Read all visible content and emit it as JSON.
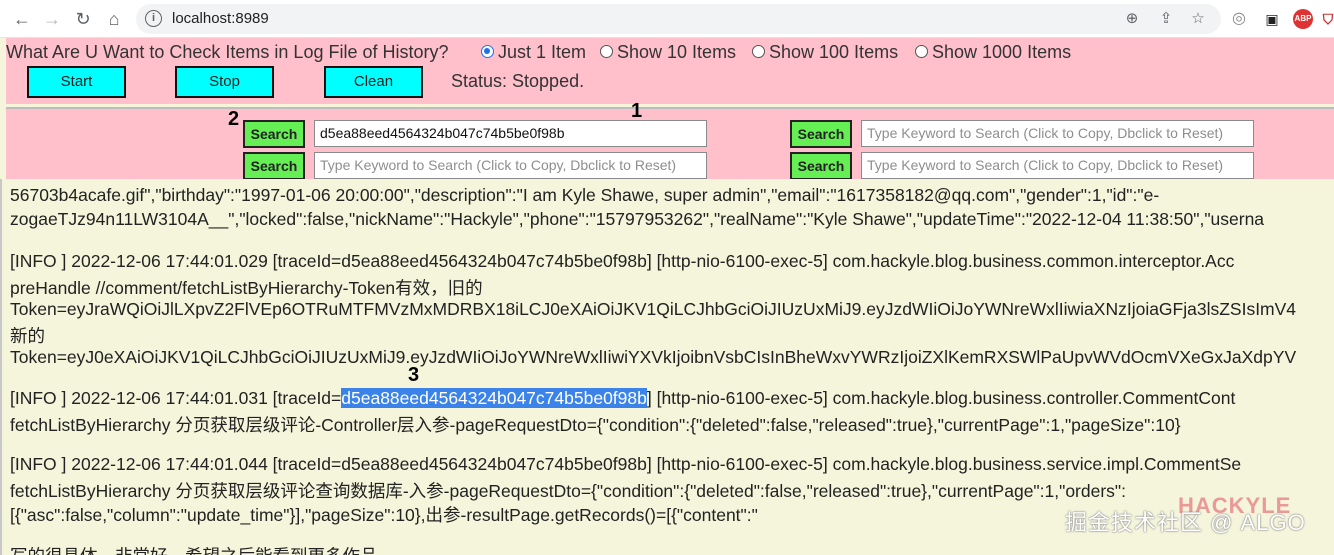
{
  "browser": {
    "url": "localhost:8989",
    "ext_labels": [
      "ABP"
    ]
  },
  "controls": {
    "question": "What Are U Want to Check Items in Log File of History?",
    "options": [
      "Just 1 Item",
      "Show 10 Items",
      "Show 100 Items",
      "Show 1000 Items"
    ],
    "selected_option": "Just 1 Item",
    "start_label": "Start",
    "stop_label": "Stop",
    "clean_label": "Clean",
    "status_text": "Status: Stopped."
  },
  "search": {
    "button_label": "Search",
    "placeholder": "Type Keyword to Search (Click to Copy, Dbclick to Reset)",
    "box1_value": "d5ea88eed4564324b047c74b5be0f98b",
    "markers": [
      "1",
      "2",
      "3"
    ]
  },
  "log": {
    "l0": "56703b4acafe.gif\",\"birthday\":\"1997-01-06 20:00:00\",\"description\":\"I am Kyle Shawe, super admin\",\"email\":\"1617358182@qq.com\",\"gender\":1,\"id\":\"e-",
    "l1": "zogaeTJz94n11LW3104A__\",\"locked\":false,\"nickName\":\"Hackyle\",\"phone\":\"15797953262\",\"realName\":\"Kyle Shawe\",\"updateTime\":\"2022-12-04 11:38:50\",\"userna",
    "l2": "[INFO ] 2022-12-06 17:44:01.029 [traceId=d5ea88eed4564324b047c74b5be0f98b] [http-nio-6100-exec-5] com.hackyle.blog.business.common.interceptor.Acc",
    "l3": "preHandle //comment/fetchListByHierarchy-Token有效，旧的",
    "l4": "Token=eyJraWQiOiJlLXpvZ2FlVEp6OTRuMTFMVzMxMDRBX18iLCJ0eXAiOiJKV1QiLCJhbGciOiJIUzUxMiJ9.eyJzdWIiOiJoYWNreWxlIiwiaXNzIjoiaGFja3lsZSIsImV4",
    "l5": "新的",
    "l6": "Token=eyJ0eXAiOiJKV1QiLCJhbGciOiJIUzUxMiJ9.eyJzdWIiOiJoYWNreWxlIiwiYXVkIjoibnVsbCIsInBheWxvYWRzIjoiZXlKemRXSWlPaUpvWVdOcmVXeGxJaXdpYV",
    "l7_pre": "[INFO ] 2022-12-06 17:44:01.031 [traceId=",
    "l7_hl": "d5ea88eed4564324b047c74b5be0f98b",
    "l7_post": "] [http-nio-6100-exec-5] com.hackyle.blog.business.controller.CommentCont",
    "l8": "fetchListByHierarchy 分页获取层级评论-Controller层入参-pageRequestDto={\"condition\":{\"deleted\":false,\"released\":true},\"currentPage\":1,\"pageSize\":10}",
    "l9": "[INFO ] 2022-12-06 17:44:01.044 [traceId=d5ea88eed4564324b047c74b5be0f98b] [http-nio-6100-exec-5] com.hackyle.blog.business.service.impl.CommentSe",
    "l10": "fetchListByHierarchy 分页获取层级评论查询数据库-入参-pageRequestDto={\"condition\":{\"deleted\":false,\"released\":true},\"currentPage\":1,\"orders\":",
    "l11": "[{\"asc\":false,\"column\":\"update_time\"}],\"pageSize\":10},出参-resultPage.getRecords()=[{\"content\":\"",
    "l12": "写的很具体，非常好，希望之后能看到更多作品"
  },
  "watermark": {
    "brand": "HACKYLE",
    "site": "掘金技术社区 @ ALGO"
  }
}
